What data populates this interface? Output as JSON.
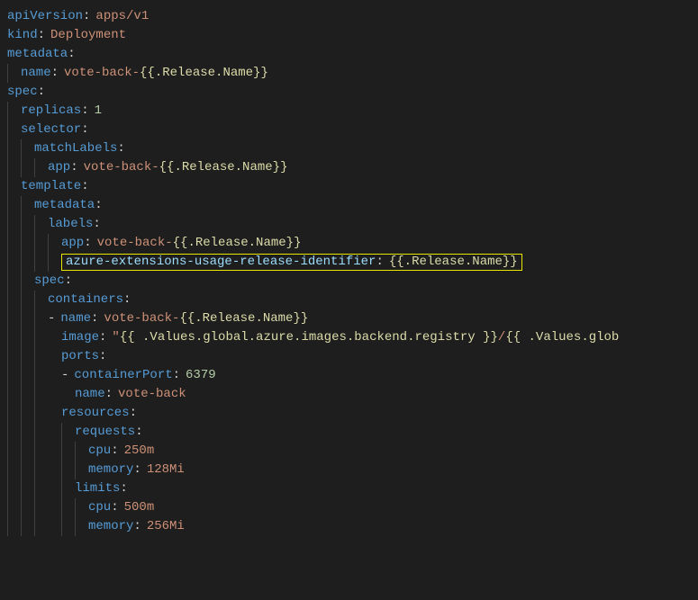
{
  "yaml": {
    "apiVersion_key": "apiVersion",
    "apiVersion_val": "apps/v1",
    "kind_key": "kind",
    "kind_val": "Deployment",
    "metadata_key": "metadata",
    "name_key": "name",
    "name_prefix": "vote-back-",
    "release_tmpl": "{{.Release.Name}}",
    "spec_key": "spec",
    "replicas_key": "replicas",
    "replicas_val": "1",
    "selector_key": "selector",
    "matchLabels_key": "matchLabels",
    "app_key": "app",
    "template_key": "template",
    "labels_key": "labels",
    "azure_key": "azure-extensions-usage-release-identifier",
    "containers_key": "containers",
    "image_key": "image",
    "image_quote": "\"",
    "image_tmpl1": "{{ .Values.global.azure.images.backend.registry }}",
    "image_sep": "/",
    "image_tmpl2": "{{ .Values.glob",
    "ports_key": "ports",
    "containerPort_key": "containerPort",
    "containerPort_val": "6379",
    "port_name_val": "vote-back",
    "resources_key": "resources",
    "requests_key": "requests",
    "cpu_key": "cpu",
    "req_cpu_val": "250m",
    "memory_key": "memory",
    "req_mem_val": "128Mi",
    "limits_key": "limits",
    "lim_cpu_val": "500m",
    "lim_mem_val": "256Mi"
  }
}
